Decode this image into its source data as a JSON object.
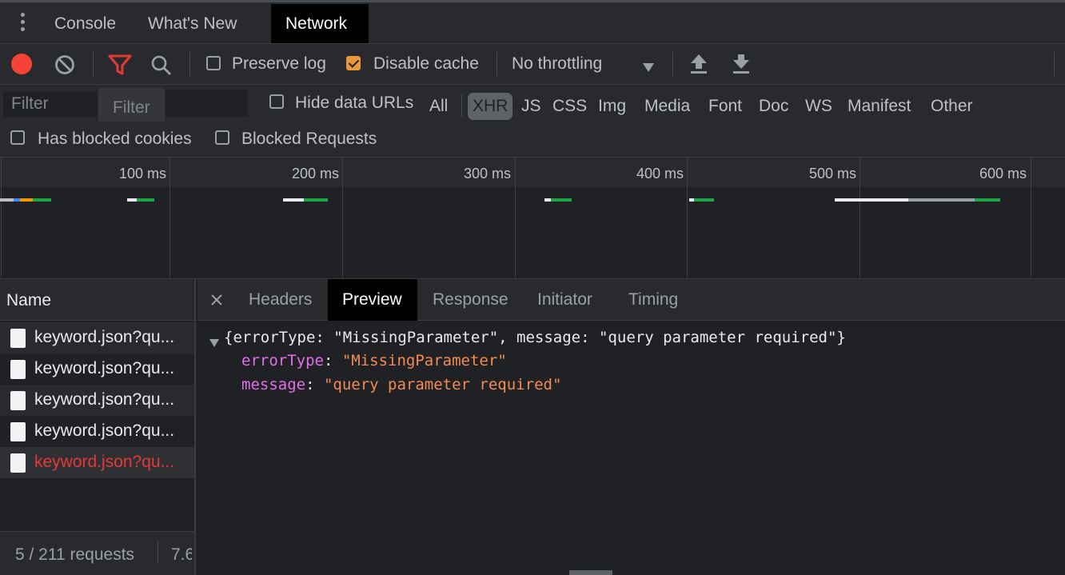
{
  "tabs": {
    "items": [
      "Console",
      "What's New",
      "Network"
    ],
    "active": "Network"
  },
  "toolbar": {
    "preserve_log": "Preserve log",
    "disable_cache": "Disable cache",
    "throttling": "No throttling",
    "preserve_log_checked": false,
    "disable_cache_checked": true
  },
  "filterbar": {
    "filter_placeholder": "Filter",
    "filter_placeholder_2": "Filter",
    "hide_data_urls": "Hide data URLs",
    "types": [
      "All",
      "XHR",
      "JS",
      "CSS",
      "Img",
      "Media",
      "Font",
      "Doc",
      "WS",
      "Manifest",
      "Other"
    ],
    "active_type": "XHR",
    "has_blocked_cookies": "Has blocked cookies",
    "blocked_requests": "Blocked Requests"
  },
  "overview": {
    "ticks": [
      "100 ms",
      "200 ms",
      "300 ms",
      "400 ms",
      "500 ms",
      "600 ms"
    ]
  },
  "requests": {
    "header": "Name",
    "rows": [
      {
        "name": "keyword.json?qu...",
        "error": false
      },
      {
        "name": "keyword.json?qu...",
        "error": false
      },
      {
        "name": "keyword.json?qu...",
        "error": false
      },
      {
        "name": "keyword.json?qu...",
        "error": false
      },
      {
        "name": "keyword.json?qu...",
        "error": true
      }
    ],
    "status": "5 / 211 requests",
    "status_size": "7.6"
  },
  "preview": {
    "tabs": [
      "Headers",
      "Preview",
      "Response",
      "Initiator",
      "Timing"
    ],
    "active_tab": "Preview",
    "summary": "{errorType: \"MissingParameter\", message: \"query parameter required\"}",
    "props": [
      {
        "key": "errorType",
        "value": "\"MissingParameter\""
      },
      {
        "key": "message",
        "value": "\"query parameter required\""
      }
    ]
  },
  "colors": {
    "record": "#f44336",
    "filter_active": "#e53935",
    "checkbox_checked": "#e8973a",
    "error_text": "#e53935",
    "json_key": "#e36eec",
    "json_string": "#f28b54"
  },
  "icons": [
    "more-vert-icon",
    "record-icon",
    "clear-icon",
    "filter-icon",
    "search-icon",
    "dropdown-arrow-icon",
    "upload-icon",
    "download-icon",
    "close-icon",
    "expand-triangle-icon",
    "document-icon"
  ]
}
